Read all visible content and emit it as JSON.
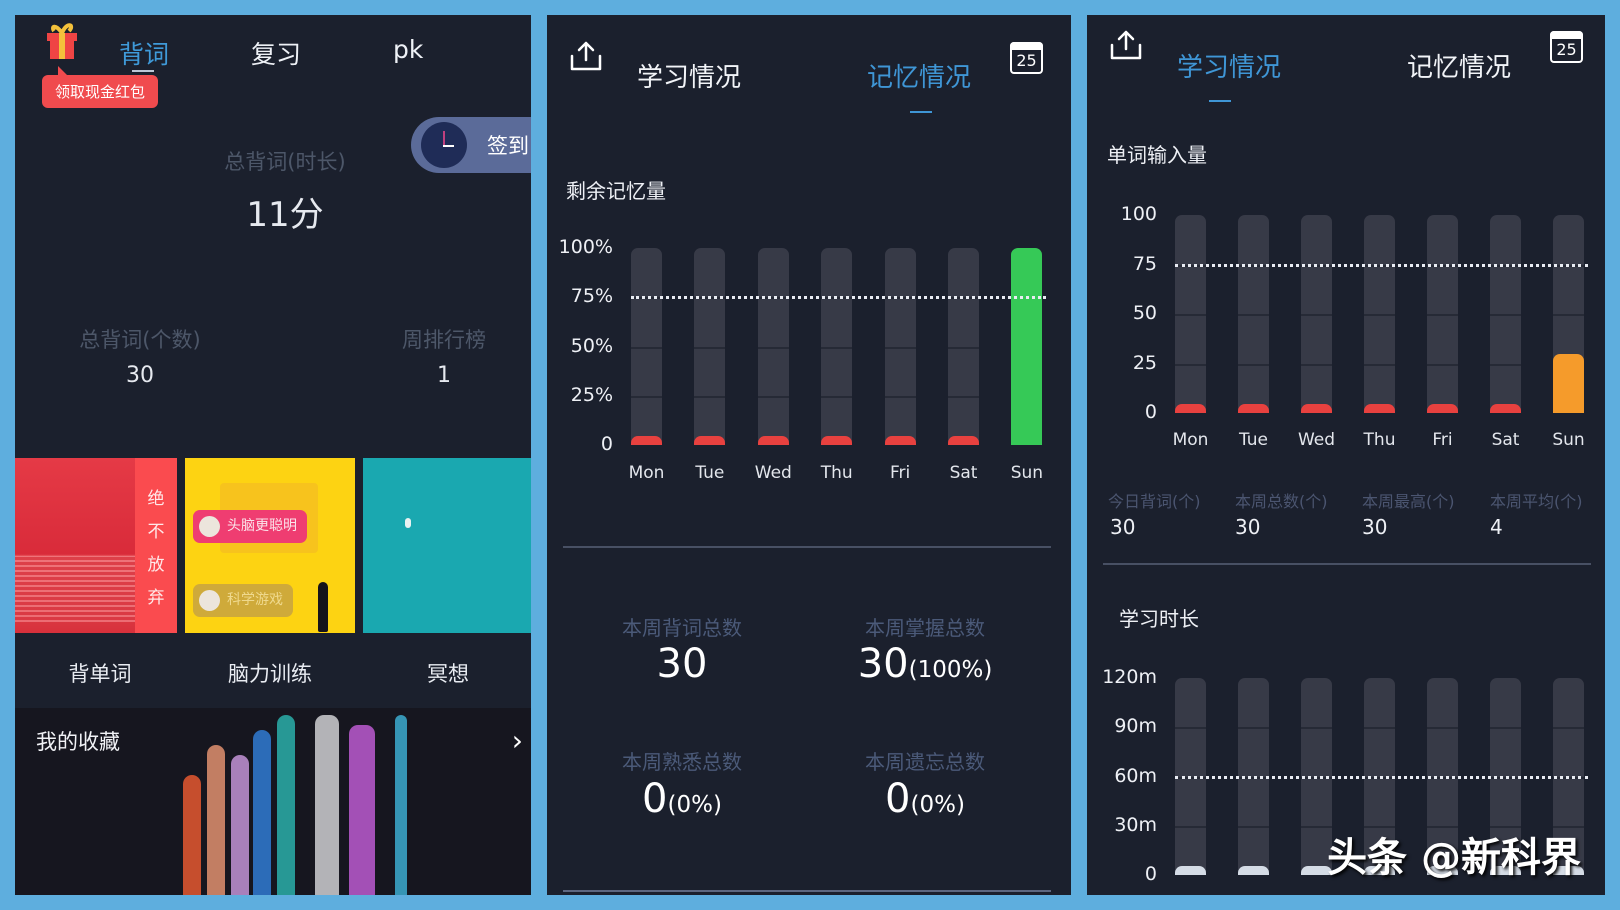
{
  "home": {
    "gift_icon": "gift-icon",
    "redpacket_tip": "领取现金红包",
    "tabs": [
      {
        "label": "背词",
        "active": true
      },
      {
        "label": "复习",
        "active": false
      },
      {
        "label": "pk",
        "active": false
      }
    ],
    "total_duration": {
      "label": "总背词(时长)",
      "value": "11分"
    },
    "signin": {
      "icon": "clock-icon",
      "label": "签到"
    },
    "total_count": {
      "label": "总背词(个数)",
      "value": "30"
    },
    "weekly_rank": {
      "label": "周排行榜",
      "value": "1"
    },
    "tiles": [
      {
        "label": "背单词",
        "banner_text": [
          "绝",
          "不",
          "放",
          "弃"
        ]
      },
      {
        "label": "脑力训练",
        "pills": [
          "头脑更聪明",
          "科学游戏"
        ]
      },
      {
        "label": "冥想"
      }
    ],
    "favorites": {
      "title": "我的收藏",
      "chevron": "chevron-right-icon"
    }
  },
  "memory_panel": {
    "tabs": [
      {
        "label": "学习情况",
        "active": false
      },
      {
        "label": "记忆情况",
        "active": true
      }
    ],
    "calendar_day": "25",
    "section_title": "剩余记忆量",
    "kpis": [
      {
        "label": "本周背词总数",
        "value": "30",
        "suffix": ""
      },
      {
        "label": "本周掌握总数",
        "value": "30",
        "suffix": "(100%)"
      },
      {
        "label": "本周熟悉总数",
        "value": "0",
        "suffix": "(0%)"
      },
      {
        "label": "本周遗忘总数",
        "value": "0",
        "suffix": "(0%)"
      }
    ]
  },
  "study_panel": {
    "tabs": [
      {
        "label": "学习情况",
        "active": true
      },
      {
        "label": "记忆情况",
        "active": false
      }
    ],
    "calendar_day": "25",
    "word_input_title": "单词输入量",
    "stats": [
      {
        "label": "今日背词(个)",
        "value": "30"
      },
      {
        "label": "本周总数(个)",
        "value": "30"
      },
      {
        "label": "本周最高(个)",
        "value": "30"
      },
      {
        "label": "本周平均(个)",
        "value": "4"
      }
    ],
    "duration_title": "学习时长"
  },
  "watermark": "头条 @新科界",
  "chart_data": [
    {
      "id": "remaining-memory",
      "type": "bar",
      "title": "剩余记忆量",
      "categories": [
        "Mon",
        "Tue",
        "Wed",
        "Thu",
        "Fri",
        "Sat",
        "Sun"
      ],
      "values": [
        0,
        0,
        0,
        0,
        0,
        0,
        100
      ],
      "yticks": [
        "0",
        "25%",
        "50%",
        "75%",
        "100%"
      ],
      "ylim": [
        0,
        100
      ],
      "reference_line": 75,
      "colors": {
        "zero": "#e8413f",
        "value": "#36c957",
        "track": "#373a47"
      }
    },
    {
      "id": "word-input",
      "type": "bar",
      "title": "单词输入量",
      "categories": [
        "Mon",
        "Tue",
        "Wed",
        "Thu",
        "Fri",
        "Sat",
        "Sun"
      ],
      "values": [
        0,
        0,
        0,
        0,
        0,
        0,
        30
      ],
      "yticks": [
        "0",
        "25",
        "50",
        "75",
        "100"
      ],
      "ylim": [
        0,
        100
      ],
      "reference_line": 75,
      "colors": {
        "zero": "#e8413f",
        "value": "#f59b2b",
        "track": "#373a47"
      }
    },
    {
      "id": "study-duration",
      "type": "bar",
      "title": "学习时长",
      "categories": [
        "Mon",
        "Tue",
        "Wed",
        "Thu",
        "Fri",
        "Sat",
        "Sun"
      ],
      "values": [
        0,
        0,
        0,
        0,
        0,
        0,
        11
      ],
      "yticks": [
        "0",
        "30m",
        "60m",
        "90m",
        "120m"
      ],
      "ylim": [
        0,
        120
      ],
      "reference_line": 60,
      "colors": {
        "zero": "#d5dce6",
        "value": "#d5dce6",
        "track": "#373a47"
      }
    }
  ]
}
